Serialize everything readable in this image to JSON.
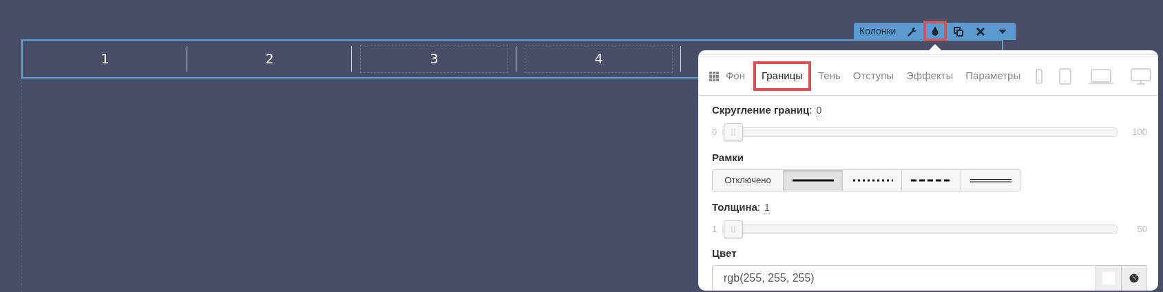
{
  "toolbar": {
    "title": "Колонки",
    "buttons": [
      {
        "kind": "wrench",
        "highlighted": false
      },
      {
        "kind": "drop",
        "highlighted": true
      },
      {
        "kind": "copy",
        "highlighted": false
      },
      {
        "kind": "close",
        "highlighted": false
      },
      {
        "kind": "caret",
        "highlighted": false
      }
    ]
  },
  "columns": [
    {
      "label": "1",
      "dashed": false
    },
    {
      "label": "2",
      "dashed": false
    },
    {
      "label": "3",
      "dashed": true
    },
    {
      "label": "4",
      "dashed": true
    }
  ],
  "panel": {
    "tabs": [
      {
        "label": "Фон",
        "selected": false,
        "highlighted": false
      },
      {
        "label": "Границы",
        "selected": true,
        "highlighted": true
      },
      {
        "label": "Тень",
        "selected": false,
        "highlighted": false
      },
      {
        "label": "Отступы",
        "selected": false,
        "highlighted": false
      },
      {
        "label": "Эффекты",
        "selected": false,
        "highlighted": false
      },
      {
        "label": "Параметры",
        "selected": false,
        "highlighted": false
      }
    ],
    "devices": [
      {
        "kind": "phone"
      },
      {
        "kind": "tablet"
      },
      {
        "kind": "laptop"
      },
      {
        "kind": "desktop"
      }
    ],
    "radius": {
      "label": "**Скругление границ**:",
      "value": "0",
      "min": "0",
      "max": "100",
      "level": 0
    },
    "frames": {
      "label": "Рамки",
      "options": [
        {
          "kind": "text",
          "label": "Отключено",
          "selected": false
        },
        {
          "kind": "solid",
          "selected": true
        },
        {
          "kind": "dotted",
          "selected": false
        },
        {
          "kind": "dashed",
          "selected": false
        },
        {
          "kind": "double",
          "selected": false
        }
      ]
    },
    "thickness": {
      "label": "**Толщина**:",
      "value": "1",
      "min": "1",
      "max": "50",
      "level": 0
    },
    "color": {
      "label": "Цвет",
      "value": "rgb(255, 255, 255)"
    }
  }
}
